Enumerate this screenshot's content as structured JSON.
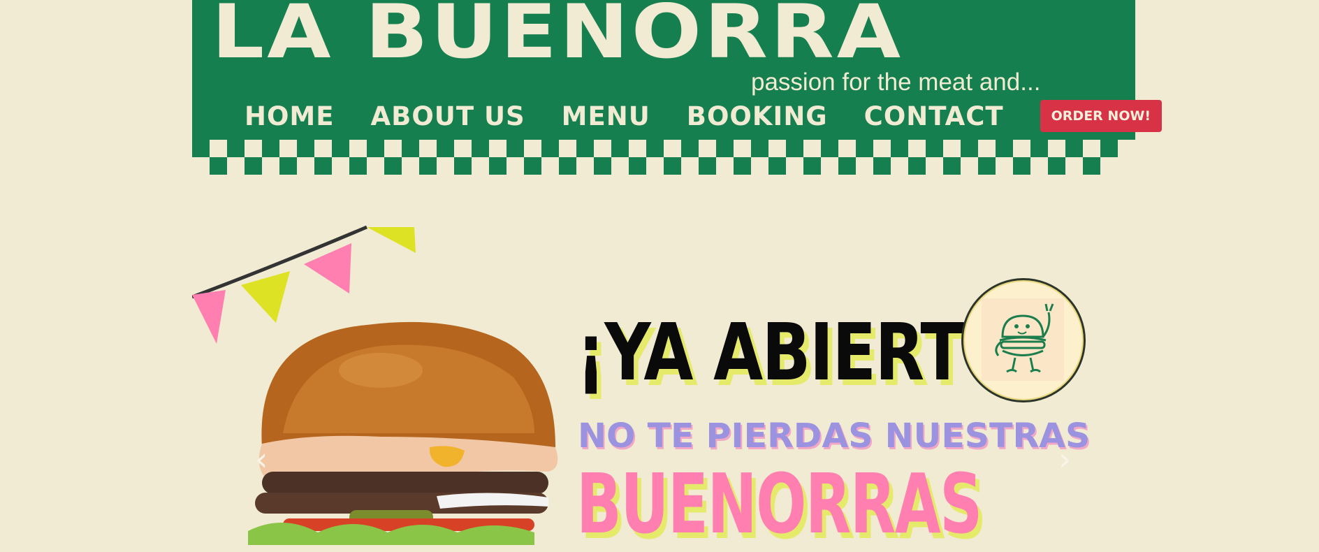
{
  "brand": {
    "name": "LA BUENORRA",
    "tagline": "passion for the meat and..."
  },
  "nav": {
    "items": [
      {
        "label": "HOME"
      },
      {
        "label": "ABOUT US"
      },
      {
        "label": "MENU"
      },
      {
        "label": "BOOKING"
      },
      {
        "label": "CONTACT"
      }
    ],
    "order_label": "ORDER NOW!"
  },
  "hero": {
    "headline": "¡YA ABIERTO!",
    "subline": "NO TE PIERDAS NUESTRAS",
    "highlight": "BUENORRAS",
    "prev_arrow": "‹",
    "next_arrow": "›"
  },
  "colors": {
    "background": "#f0ebd2",
    "header_green": "#167f4f",
    "order_red": "#d73246",
    "headline_pink": "#ff7fb0",
    "subline_purple": "#9b93e0",
    "shadow_yellow": "#e6ea6a"
  },
  "icons": [
    "burger-mascot-icon",
    "chevron-left-icon",
    "chevron-right-icon"
  ]
}
